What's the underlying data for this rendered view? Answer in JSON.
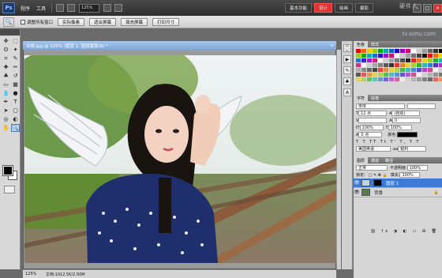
{
  "app": {
    "logo": "Ps"
  },
  "menu": {
    "items": [
      "程序",
      "工具"
    ],
    "zoom": "125%",
    "workspace_buttons": [
      "基本功能",
      "设计",
      "绘画",
      "摄影"
    ],
    "active_workspace": 1,
    "watermark": "硬件人",
    "watermark_url": "tv.sohu.com"
  },
  "options_bar": {
    "checkbox_label": "调整所有窗口",
    "buttons": [
      "实际像素",
      "适合屏幕",
      "填充屏幕",
      "打印尺寸"
    ]
  },
  "document": {
    "tab_title": "合成.jpg @ 125% (图层 1, 图层蒙版/8) *",
    "status": "文档:1012.5K/2.50M"
  },
  "swatches_panel": {
    "tabs": [
      "色板",
      "样式"
    ]
  },
  "character_panel": {
    "tabs": [
      "字符",
      "段落"
    ],
    "font_family": "宋体",
    "font_size": "12 点",
    "leading": "(自动)",
    "tracking": "0",
    "scale_v": "100%",
    "scale_h": "100%",
    "baseline": "0 点",
    "color_label": "颜色:",
    "antialias": "锐利",
    "language": "美国英语"
  },
  "layers_panel": {
    "tabs": [
      "图层",
      "通道",
      "路径"
    ],
    "blend_mode": "正常",
    "opacity_label": "不透明度:",
    "opacity": "100%",
    "lock_label": "锁定:",
    "fill_label": "填充:",
    "fill": "100%",
    "layers": [
      {
        "name": "图层 1",
        "selected": true,
        "has_mask": true
      },
      {
        "name": "背景",
        "selected": false,
        "locked": true
      }
    ]
  },
  "colors": {
    "accent": "#d33",
    "selection": "#3d7ad6",
    "doc_tab": "#7ea6d8"
  }
}
